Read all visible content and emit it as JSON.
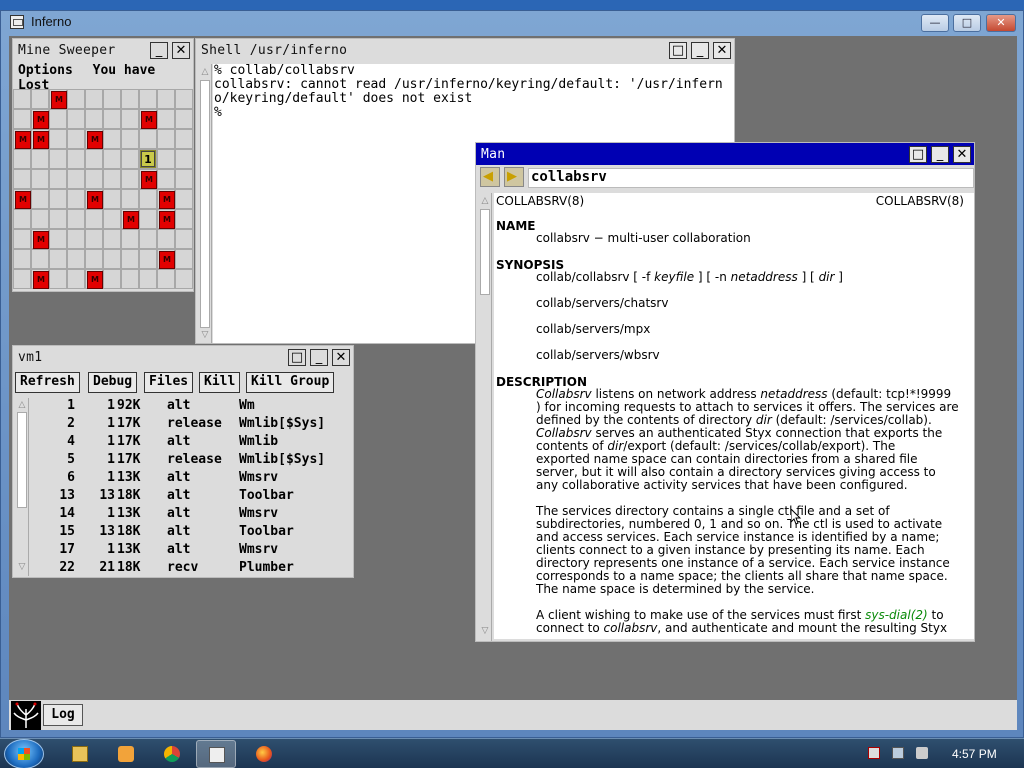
{
  "host": {
    "title": "Inferno"
  },
  "minesweeper": {
    "title": "Mine Sweeper",
    "menu_options": "Options",
    "status": "You have Lost",
    "grid": [
      "..M.......",
      ".M.....M..",
      "MM..M.....",
      ".......1..",
      ".......M..",
      "M...M...M.",
      "......M.M.",
      ".M........",
      "........M.",
      ".M..M....."
    ]
  },
  "shell": {
    "title": "Shell /usr/inferno",
    "lines": [
      "% collab/collabsrv",
      "collabsrv: cannot read /usr/inferno/keyring/default: '/usr/infern",
      "o/keyring/default' does not exist",
      "%"
    ]
  },
  "vm1": {
    "title": "vm1",
    "buttons": [
      "Refresh",
      "Debug",
      "Files",
      "Kill",
      "Kill Group"
    ],
    "rows": [
      [
        "1",
        "1",
        "92K",
        "alt",
        "Wm"
      ],
      [
        "2",
        "1",
        "17K",
        "release",
        "Wmlib[$Sys]"
      ],
      [
        "4",
        "1",
        "17K",
        "alt",
        "Wmlib"
      ],
      [
        "5",
        "1",
        "17K",
        "release",
        "Wmlib[$Sys]"
      ],
      [
        "6",
        "1",
        "13K",
        "alt",
        "Wmsrv"
      ],
      [
        "13",
        "13",
        "18K",
        "alt",
        "Toolbar"
      ],
      [
        "14",
        "1",
        "13K",
        "alt",
        "Wmsrv"
      ],
      [
        "15",
        "13",
        "18K",
        "alt",
        "Toolbar"
      ],
      [
        "17",
        "1",
        "13K",
        "alt",
        "Wmsrv"
      ],
      [
        "22",
        "21",
        "18K",
        "recv",
        "Plumber"
      ]
    ]
  },
  "man": {
    "title": "Man",
    "query": "collabsrv",
    "header_left": "COLLABSRV(8)",
    "header_right": "COLLABSRV(8)",
    "sec_name": "NAME",
    "name_text": "collabsrv − multi-user collaboration",
    "sec_synopsis": "SYNOPSIS",
    "syn_cmd": "collab/collabsrv [ -f ",
    "syn_keyfile": "keyfile",
    "syn_mid": " ] [ -n ",
    "syn_netaddress": "netaddress",
    "syn_mid2": " ] [ ",
    "syn_dir": "dir",
    "syn_end": " ]",
    "syn_2": "collab/servers/chatsrv",
    "syn_3": "collab/servers/mpx",
    "syn_4": "collab/servers/wbsrv",
    "sec_description": "DESCRIPTION",
    "d1_lines": [
      {
        "pre": "",
        "it": "Collabsrv",
        "post": " listens on network address ",
        "it2": "netaddress",
        "post2": " (default:  tcp!*!9999"
      },
      {
        "pre": ") for incoming requests to attach to services it offers. The services are",
        "it": "",
        "post": "",
        "it2": "",
        "post2": ""
      },
      {
        "pre": "defined by the contents of directory ",
        "it": "dir",
        "post": " (default:  /services/collab).",
        "it2": "",
        "post2": ""
      },
      {
        "pre": "",
        "it": "Collabsrv",
        "post": " serves an authenticated Styx connection that exports the",
        "it2": "",
        "post2": ""
      },
      {
        "pre": "contents of ",
        "it": "dir",
        "post": "/export (default:  /services/collab/export). The",
        "it2": "",
        "post2": ""
      },
      {
        "pre": "exported name space can contain directories from a shared file",
        "it": "",
        "post": "",
        "it2": "",
        "post2": ""
      },
      {
        "pre": "server, but it will also contain a directory  services giving access to",
        "it": "",
        "post": "",
        "it2": "",
        "post2": ""
      },
      {
        "pre": "any collaborative activity services that have been configured.",
        "it": "",
        "post": "",
        "it2": "",
        "post2": ""
      }
    ],
    "d2_lines": [
      "The  services directory contains a single  ctl file and a set of",
      "subdirectories, numbered  0, 1 and so on. The  ctl is used to activate",
      "and access services. Each service instance is identified by a name;",
      "clients connect to a given instance by presenting its name. Each",
      "directory represents one instance of a service. Each service instance",
      "corresponds to a name space; the clients all share that name space.",
      "The name space is determined by the service."
    ],
    "d3_pre": "A client wishing to make use of the services must first ",
    "d3_link": "sys-dial(2)",
    "d3_post": " to",
    "d3_line2_pre": "connect to ",
    "d3_line2_it": "collabsrv",
    "d3_line2_post": ", and authenticate and mount the resulting Styx"
  },
  "logbar": {
    "log_label": "Log"
  },
  "taskbar": {
    "clock": "4:57 PM"
  }
}
